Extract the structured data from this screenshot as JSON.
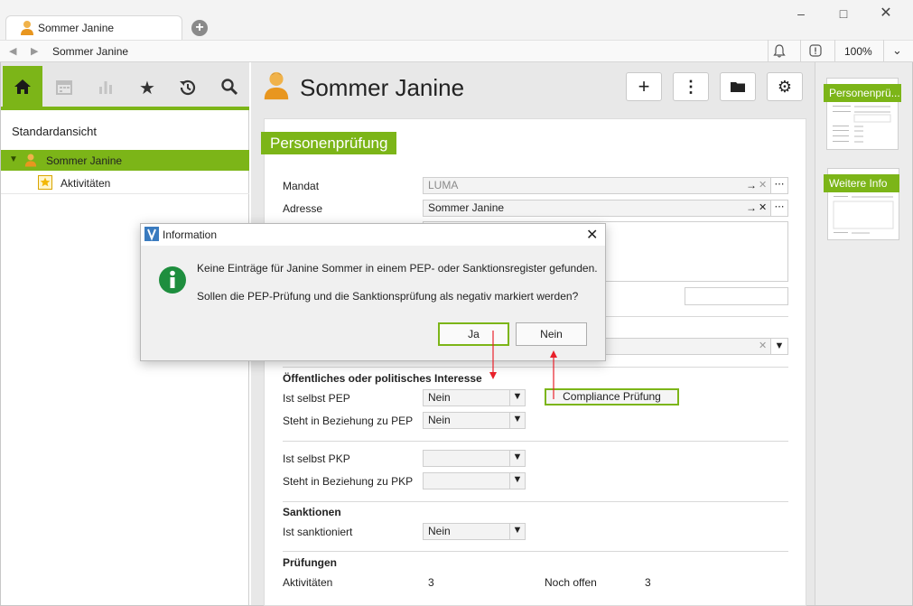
{
  "window": {
    "tab_title": "Sommer Janine",
    "address_title": "Sommer Janine",
    "zoom": "100%"
  },
  "nav": {
    "icons": [
      "home-icon",
      "calendar-icon",
      "chart-icon",
      "star-icon",
      "history-icon",
      "search-icon"
    ],
    "view_title": "Standardansicht",
    "tree": [
      {
        "label": "Sommer Janine",
        "selected": true
      },
      {
        "label": "Aktivitäten",
        "selected": false
      }
    ]
  },
  "header": {
    "name": "Sommer Janine",
    "buttons": [
      "plus-icon",
      "more-icon",
      "folder-icon",
      "gear-icon"
    ]
  },
  "form": {
    "section_title": "Personenprüfung",
    "mandat_label": "Mandat",
    "mandat_value": "LUMA",
    "adresse_label": "Adresse",
    "adresse_value": "Sommer Janine",
    "interest_header": "Öffentliches oder politisches Interesse",
    "pep_label": "Ist selbst PEP",
    "pep_value": "Nein",
    "pep_rel_label": "Steht in Beziehung zu PEP",
    "pep_rel_value": "Nein",
    "compliance_button": "Compliance Prüfung",
    "pkp_label": "Ist selbst PKP",
    "pkp_value": "",
    "pkp_rel_label": "Steht in Beziehung zu PKP",
    "pkp_rel_value": "",
    "sanctions_header": "Sanktionen",
    "sanctioned_label": "Ist sanktioniert",
    "sanctioned_value": "Nein",
    "checks_header": "Prüfungen",
    "activities_label": "Aktivitäten",
    "activities_value": "3",
    "open_label": "Noch offen",
    "open_value": "3"
  },
  "thumbnails": [
    {
      "label": "Personenprü..."
    },
    {
      "label": "Weitere Info"
    }
  ],
  "dialog": {
    "title": "Information",
    "line1": "Keine Einträge für Janine Sommer in einem PEP- oder Sanktionsregister gefunden.",
    "line2": "Sollen die PEP-Prüfung und die Sanktionsprüfung als negativ markiert werden?",
    "yes_label": "Ja",
    "no_label": "Nein"
  },
  "colors": {
    "accent": "#7cb518",
    "annotation": "#e8202a",
    "info_icon": "#1e8e3e"
  }
}
